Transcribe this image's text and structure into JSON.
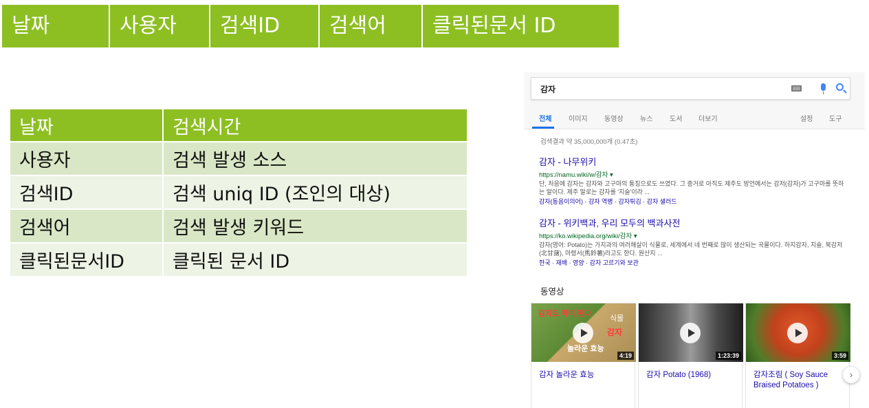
{
  "top_header": {
    "columns": [
      "날짜",
      "사용자",
      "검색ID",
      "검색어",
      "클릭된문서 ID"
    ]
  },
  "schema_table": {
    "header": [
      "날짜",
      "검색시간"
    ],
    "rows": [
      [
        "사용자",
        "검색 발생 소스"
      ],
      [
        "검색ID",
        "검색 uniq ID (조인의 대상)"
      ],
      [
        "검색어",
        "검색 발생 키워드"
      ],
      [
        "클릭된문서ID",
        "클릭된 문서 ID"
      ]
    ]
  },
  "serp": {
    "query": "감자",
    "tabs": [
      "전체",
      "이미지",
      "동영상",
      "뉴스",
      "도서",
      "더보기"
    ],
    "tools": [
      "설정",
      "도구"
    ],
    "result_stats": "검색결과 약 35,000,000개 (0.47초)",
    "results": [
      {
        "title": "감자 - 나무위키",
        "url": "https://namu.wiki/w/감자",
        "snippet": "단, 처음에 감자는 감자와 고구마의 통칭으로도 쓰였다. 그 증거로 아직도 제주도 방언에서는 감저(감자)가 고구마를 뜻하는 말이다. 제주 말로는 감자를 '지슬'이라 ...",
        "links": "감자(동음이의어) · 감자 역병 · 감자튀김 · 감자 샐러드"
      },
      {
        "title": "감자 - 위키백과, 우리 모두의 백과사전",
        "url": "https://ko.wikipedia.org/wiki/감자",
        "snippet": "감자(영어: Potato)는 가지과의 여러해살이 식물로, 세계에서 네 번째로 많이 생산되는 곡물이다. 하지감자, 지슬, 북감저(北甘藷), 마령서(馬鈴薯)라고도 한다. 원산지 ...",
        "links": "한국 · 재배 · 영양 · 감자 고르기와 보관"
      }
    ],
    "video_heading": "동영상",
    "videos": [
      {
        "title": "감자 놀라운 효능",
        "duration": "4:19",
        "overlay_top": "감자도 약이 된다",
        "overlay_right1": "식물",
        "overlay_right2": "감자",
        "overlay_bottom": "놀라운 효능"
      },
      {
        "title": "감자 Potato (1968)",
        "duration": "1:23:39"
      },
      {
        "title": "감자조림 ( Soy Sauce Braised Potatoes )",
        "duration": "3:59"
      }
    ]
  },
  "colors": {
    "header_green": "#8dbf23",
    "row_dark": "#d9e7c6",
    "row_light": "#edf3e5",
    "link_blue": "#1a0dab",
    "url_green": "#006621"
  }
}
